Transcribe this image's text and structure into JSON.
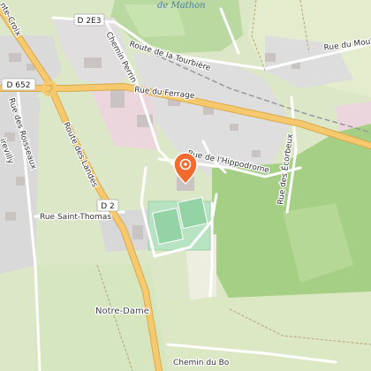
{
  "map": {
    "labels": {
      "mathon": "de Mathon",
      "d2e3": "D 2E3",
      "chemin_perrin": "Chemin Perrin",
      "route_tourbiere": "Route de la Tourbière",
      "rue_moulin": "Rue du Moulin",
      "d652": "D 652",
      "rue_ferrage": "Rue du Ferrage",
      "rue_roisseaux": "Rue des Roisseaux",
      "route_landes": "Route des Landes",
      "rue_hippodrome": "Rue de l'Hippodrome",
      "rue_ecorbeux": "Rue des Écorbeux",
      "rue_saint_thomas": "Rue Saint-Thomas",
      "d2": "D 2",
      "notre_dame": "Notre-Dame",
      "chemin_bas": "Chemin du Bo",
      "croix": "nte-Croix",
      "poirevilly": "irevilly"
    },
    "colors": {
      "marker": "#f26a2e",
      "main_road": "#f7c96e",
      "field": "#cfe0b6",
      "forest": "#a9d38b",
      "residential": "#dcdcdc",
      "pitch": "#a8dfb6"
    },
    "marker_icon": "sport-venue-icon"
  }
}
